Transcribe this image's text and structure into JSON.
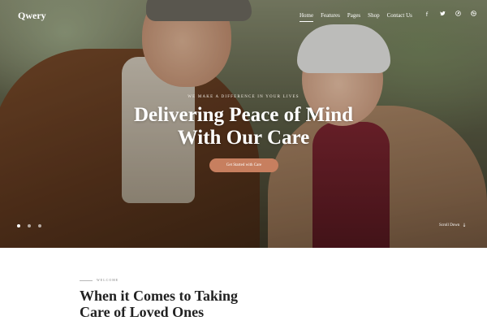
{
  "header": {
    "logo": "Qwery",
    "nav": [
      {
        "label": "Home",
        "active": true
      },
      {
        "label": "Features",
        "active": false
      },
      {
        "label": "Pages",
        "active": false
      },
      {
        "label": "Shop",
        "active": false
      },
      {
        "label": "Contact Us",
        "active": false
      }
    ],
    "socials": [
      {
        "icon": "facebook-icon",
        "glyph": "f"
      },
      {
        "icon": "twitter-icon",
        "glyph": "🐦"
      },
      {
        "icon": "pinterest-icon",
        "glyph": "℗"
      },
      {
        "icon": "dribbble-icon",
        "glyph": "⊛"
      }
    ]
  },
  "hero": {
    "eyebrow": "WE MAKE A DIFFERENCE IN YOUR LIVES",
    "title_line1": "Delivering Peace of Mind",
    "title_line2": "With Our Care",
    "cta": "Get Started with Care",
    "slides_total": 3,
    "active_slide": 1,
    "scroll_label": "Scroll Down",
    "colors": {
      "accent": "#c77f5f",
      "text": "#ffffff"
    }
  },
  "welcome": {
    "label": "WELCOME",
    "title_line1": "When it Comes to Taking",
    "title_line2": "Care of Loved Ones"
  }
}
